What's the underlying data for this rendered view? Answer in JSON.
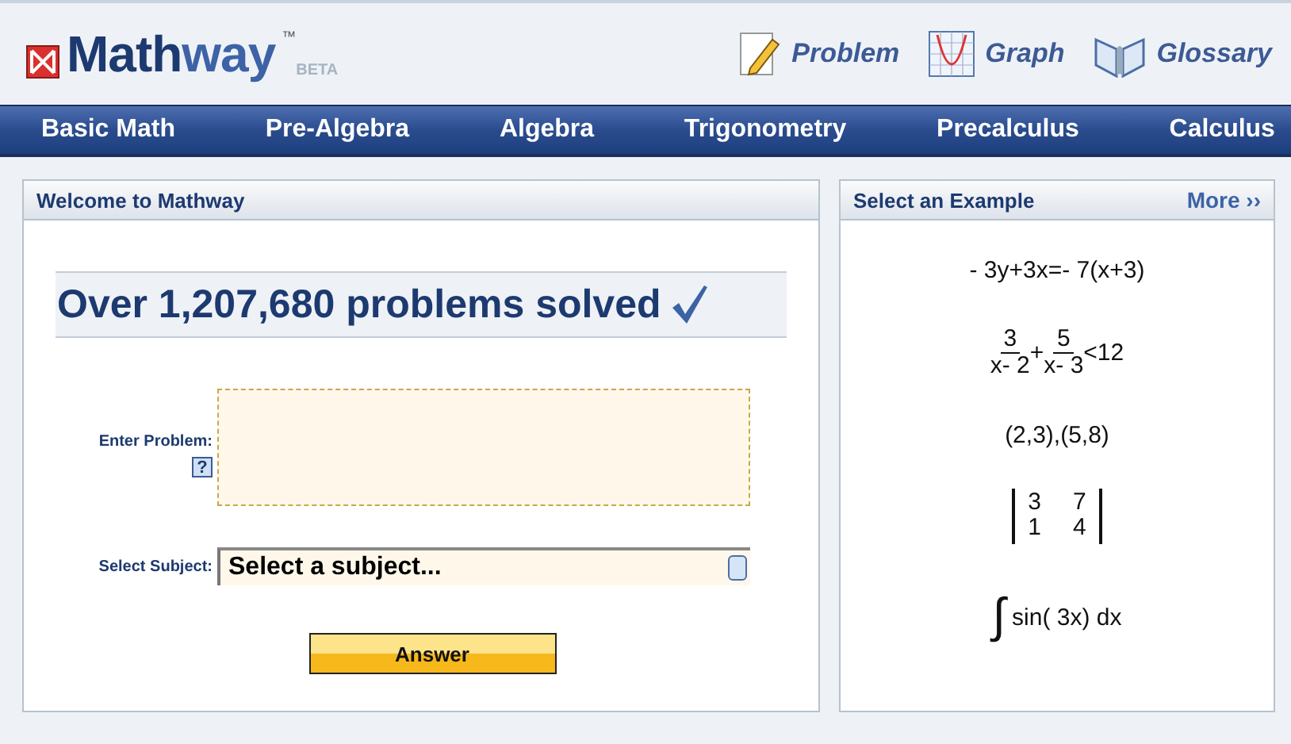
{
  "logo": {
    "wordmark": [
      "Math",
      "way"
    ],
    "trademark": "™",
    "badge": "BETA"
  },
  "header_links": [
    {
      "label": "Problem",
      "kind": "pencil"
    },
    {
      "label": "Graph",
      "kind": "graph"
    },
    {
      "label": "Glossary",
      "kind": "book"
    }
  ],
  "nav": [
    "Basic Math",
    "Pre-Algebra",
    "Algebra",
    "Trigonometry",
    "Precalculus",
    "Calculus"
  ],
  "welcome_panel": {
    "title": "Welcome to Mathway",
    "banner": "Over 1,207,680 problems solved",
    "problem_label": "Enter Problem:",
    "help": "?",
    "subject_label": "Select Subject:",
    "subject_value": "Select a subject...",
    "answer_button": "Answer"
  },
  "examples_panel": {
    "title": "Select an Example",
    "more": "More ››",
    "examples": [
      {
        "kind": "text",
        "text": "- 3y+3x=- 7(x+3)"
      },
      {
        "kind": "fractions",
        "terms": [
          {
            "num": "3",
            "den": "x- 2"
          },
          {
            "num": "5",
            "den": "x- 3"
          }
        ],
        "operator": "+",
        "rest": "<12"
      },
      {
        "kind": "text",
        "text": "(2,3),(5,8)"
      },
      {
        "kind": "matrix",
        "rows": [
          [
            "3",
            "7"
          ],
          [
            "1",
            "4"
          ]
        ]
      },
      {
        "kind": "integral",
        "sign": "∫",
        "text": "sin( 3x)  dx"
      }
    ]
  }
}
